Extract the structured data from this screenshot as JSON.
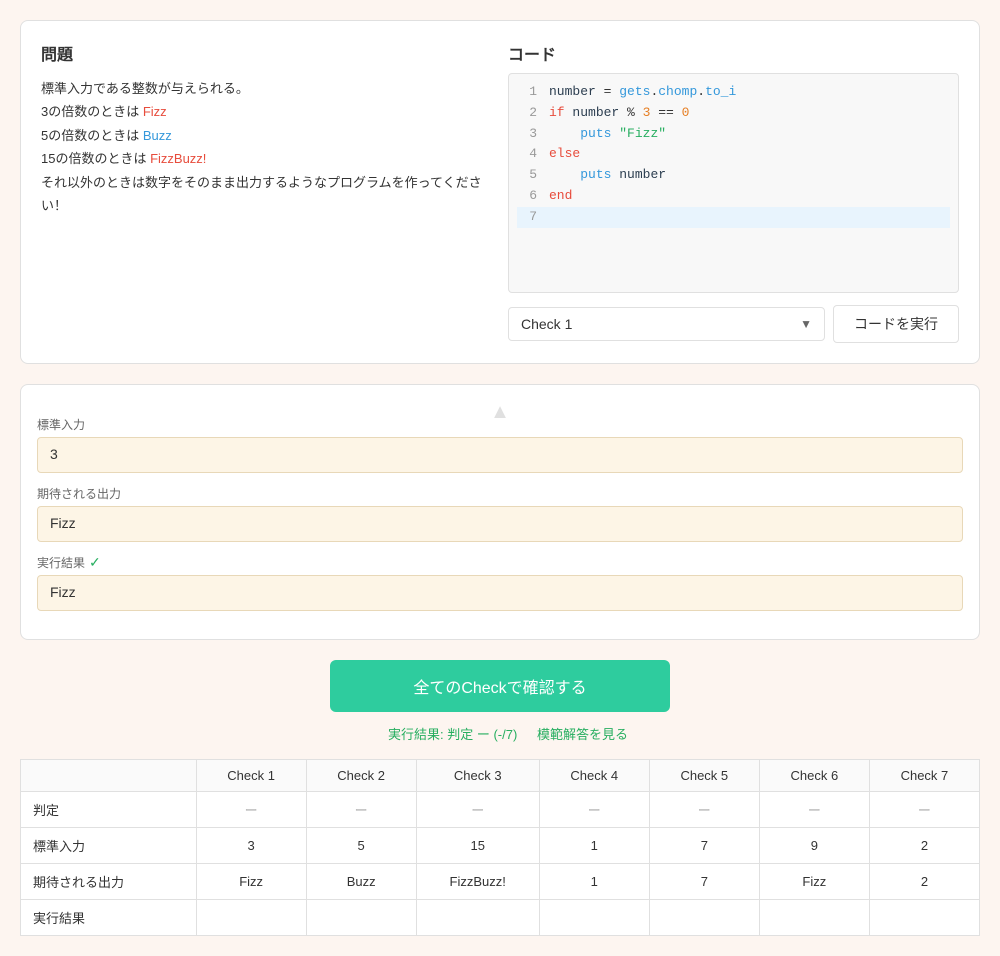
{
  "problem": {
    "title": "問題",
    "lines": [
      "標準入力である整数が与えられる。",
      "3の倍数のときは Fizz",
      "5の倍数のときは Buzz",
      "15の倍数のときは FizzBuzz!",
      "それ以外のときは数字をそのまま出力するようなプログラムを作ってください！"
    ]
  },
  "code": {
    "title": "コード",
    "lines": [
      {
        "num": "1",
        "text": "number = gets.chomp.to_i"
      },
      {
        "num": "2",
        "text": "if number % 3 == 0"
      },
      {
        "num": "3",
        "text": "  puts \"Fizz\""
      },
      {
        "num": "4",
        "text": "else"
      },
      {
        "num": "5",
        "text": "  puts number"
      },
      {
        "num": "6",
        "text": "end"
      },
      {
        "num": "7",
        "text": ""
      }
    ]
  },
  "check_selector": {
    "label": "Check 1",
    "run_button": "コードを実行"
  },
  "check_detail": {
    "stdin_label": "標準入力",
    "stdin_value": "3",
    "expected_label": "期待される出力",
    "expected_value": "Fizz",
    "result_label": "実行結果",
    "result_value": "Fizz",
    "result_ok": true
  },
  "confirm_button": "全てのCheckで確認する",
  "result_summary": {
    "text": "実行結果: 判定 ー (-/7)",
    "link": "模範解答を見る"
  },
  "table": {
    "headers": [
      "",
      "Check 1",
      "Check 2",
      "Check 3",
      "Check 4",
      "Check 5",
      "Check 6",
      "Check 7"
    ],
    "rows": [
      {
        "label": "判定",
        "values": [
          "ー",
          "ー",
          "ー",
          "ー",
          "ー",
          "ー",
          "ー"
        ]
      },
      {
        "label": "標準入力",
        "values": [
          "3",
          "5",
          "15",
          "1",
          "7",
          "9",
          "2"
        ]
      },
      {
        "label": "期待される出力",
        "values": [
          "Fizz",
          "Buzz",
          "FizzBuzz!",
          "1",
          "7",
          "Fizz",
          "2"
        ]
      },
      {
        "label": "実行結果",
        "values": [
          "",
          "",
          "",
          "",
          "",
          "",
          ""
        ]
      }
    ]
  }
}
